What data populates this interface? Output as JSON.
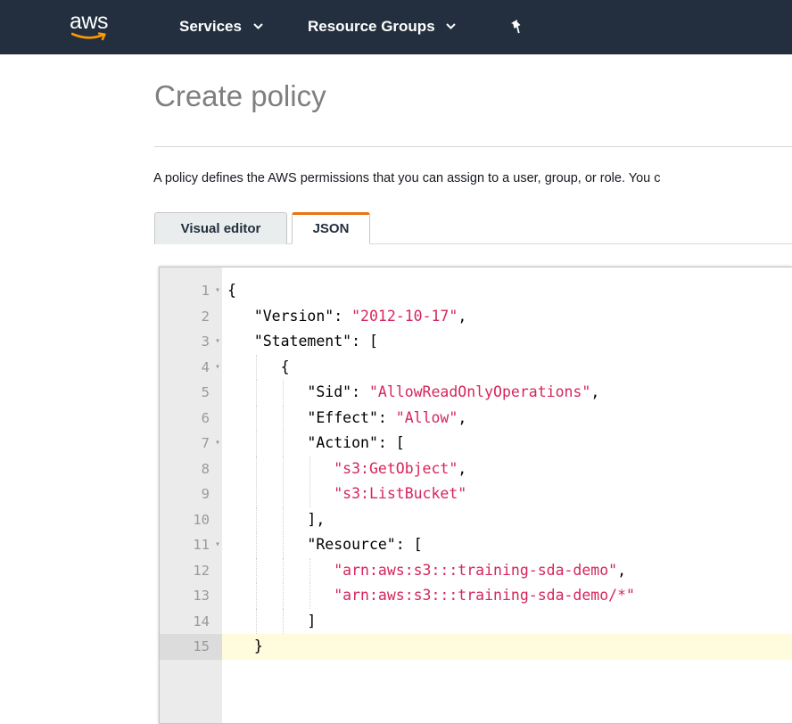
{
  "colors": {
    "nav_bg": "#232f3e",
    "accent_tab": "#ec7211",
    "string": "#d6265c",
    "active_line": "#fffbdd"
  },
  "nav": {
    "logo_text": "aws",
    "logo_icon": "aws-smile-icon",
    "items": [
      {
        "label": "Services",
        "icon": "chevron-down-icon"
      },
      {
        "label": "Resource Groups",
        "icon": "chevron-down-icon"
      }
    ],
    "pin_icon": "pin-icon"
  },
  "page": {
    "title": "Create policy",
    "description": "A policy defines the AWS permissions that you can assign to a user, group, or role. You c"
  },
  "tabs": [
    {
      "label": "Visual editor",
      "active": false
    },
    {
      "label": "JSON",
      "active": true
    }
  ],
  "editor": {
    "active_line": 15,
    "lines": [
      {
        "num": "1",
        "fold": true,
        "indent": 0,
        "parts": [
          {
            "t": "{",
            "c": "p"
          }
        ]
      },
      {
        "num": "2",
        "fold": false,
        "indent": 1,
        "parts": [
          {
            "t": "\"Version\"",
            "c": "k"
          },
          {
            "t": ": ",
            "c": "p"
          },
          {
            "t": "\"2012-10-17\"",
            "c": "s"
          },
          {
            "t": ",",
            "c": "p"
          }
        ]
      },
      {
        "num": "3",
        "fold": true,
        "indent": 1,
        "parts": [
          {
            "t": "\"Statement\"",
            "c": "k"
          },
          {
            "t": ": [",
            "c": "p"
          }
        ]
      },
      {
        "num": "4",
        "fold": true,
        "indent": 2,
        "parts": [
          {
            "t": "{",
            "c": "p"
          }
        ]
      },
      {
        "num": "5",
        "fold": false,
        "indent": 3,
        "parts": [
          {
            "t": "\"Sid\"",
            "c": "k"
          },
          {
            "t": ": ",
            "c": "p"
          },
          {
            "t": "\"AllowReadOnlyOperations\"",
            "c": "s"
          },
          {
            "t": ",",
            "c": "p"
          }
        ]
      },
      {
        "num": "6",
        "fold": false,
        "indent": 3,
        "parts": [
          {
            "t": "\"Effect\"",
            "c": "k"
          },
          {
            "t": ": ",
            "c": "p"
          },
          {
            "t": "\"Allow\"",
            "c": "s"
          },
          {
            "t": ",",
            "c": "p"
          }
        ]
      },
      {
        "num": "7",
        "fold": true,
        "indent": 3,
        "parts": [
          {
            "t": "\"Action\"",
            "c": "k"
          },
          {
            "t": ": [",
            "c": "p"
          }
        ]
      },
      {
        "num": "8",
        "fold": false,
        "indent": 4,
        "parts": [
          {
            "t": "\"s3:GetObject\"",
            "c": "s"
          },
          {
            "t": ",",
            "c": "p"
          }
        ]
      },
      {
        "num": "9",
        "fold": false,
        "indent": 4,
        "parts": [
          {
            "t": "\"s3:ListBucket\"",
            "c": "s"
          }
        ]
      },
      {
        "num": "10",
        "fold": false,
        "indent": 3,
        "parts": [
          {
            "t": "],",
            "c": "p"
          }
        ]
      },
      {
        "num": "11",
        "fold": true,
        "indent": 3,
        "parts": [
          {
            "t": "\"Resource\"",
            "c": "k"
          },
          {
            "t": ": [",
            "c": "p"
          }
        ]
      },
      {
        "num": "12",
        "fold": false,
        "indent": 4,
        "parts": [
          {
            "t": "\"arn:aws:s3:::training-sda-demo\"",
            "c": "s"
          },
          {
            "t": ",",
            "c": "p"
          }
        ]
      },
      {
        "num": "13",
        "fold": false,
        "indent": 4,
        "parts": [
          {
            "t": "\"arn:aws:s3:::training-sda-demo/*\"",
            "c": "s"
          }
        ]
      },
      {
        "num": "14",
        "fold": false,
        "indent": 3,
        "parts": [
          {
            "t": "]",
            "c": "p"
          }
        ]
      },
      {
        "num": "15",
        "fold": false,
        "indent": 1,
        "parts": [
          {
            "t": "}",
            "c": "p"
          }
        ]
      }
    ]
  }
}
